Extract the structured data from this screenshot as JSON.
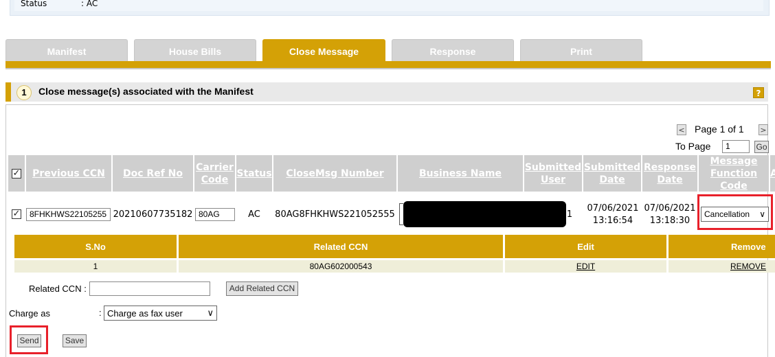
{
  "status_panel": {
    "label": "Status",
    "value": ": AC"
  },
  "tabs": [
    {
      "label": "Manifest",
      "active": false
    },
    {
      "label": "House Bills",
      "active": false
    },
    {
      "label": "Close Message",
      "active": true
    },
    {
      "label": "Response",
      "active": false
    },
    {
      "label": "Print",
      "active": false
    }
  ],
  "section": {
    "number": "1",
    "title": "Close message(s) associated with the Manifest",
    "help_icon": "?"
  },
  "pagination": {
    "prev": "<",
    "next": ">",
    "page_text": "Page 1 of 1",
    "to_page_label": "To Page",
    "to_page_value": "1",
    "go_label": "Go"
  },
  "close_table": {
    "headers": {
      "previous_ccn": "Previous CCN",
      "doc_ref_no": "Doc Ref No",
      "carrier_code": "Carrier Code",
      "status": "Status",
      "closemsg_number": "CloseMsg Number",
      "business_name": "Business Name",
      "submitted_user": "Submitted User",
      "submitted_date": "Submitted Date",
      "response_date": "Response Date",
      "message_function_code": "Message Function Code",
      "extra": "A"
    },
    "row": {
      "previous_ccn": "8FHKHWS22105255",
      "doc_ref_no": "20210607735182",
      "carrier_code": "80AG",
      "status": "AC",
      "closemsg_number": "80AG8FHKHWS221052555",
      "submitted_user_tail": "1",
      "submitted_date_1": "07/06/2021",
      "submitted_date_2": "13:16:54",
      "response_date_1": "07/06/2021",
      "response_date_2": "13:18:30",
      "message_function_code": "Cancellation"
    }
  },
  "related_table": {
    "headers": {
      "sno": "S.No",
      "related_ccn": "Related CCN",
      "edit": "Edit",
      "remove": "Remove"
    },
    "rows": [
      {
        "sno": "1",
        "related_ccn": "80AG602000543",
        "edit": "EDIT",
        "remove": "REMOVE"
      }
    ]
  },
  "form": {
    "related_ccn_label": "Related CCN :",
    "related_ccn_value": "",
    "add_related_label": "Add Related CCN",
    "charge_as_label": "Charge as",
    "charge_colon": ":",
    "charge_as_value": "Charge as fax user"
  },
  "actions": {
    "send_label": "Send",
    "save_label": "Save"
  },
  "colors": {
    "accent": "#d4a106",
    "highlight": "#e8202a",
    "header_gray": "#cfcfcf"
  }
}
